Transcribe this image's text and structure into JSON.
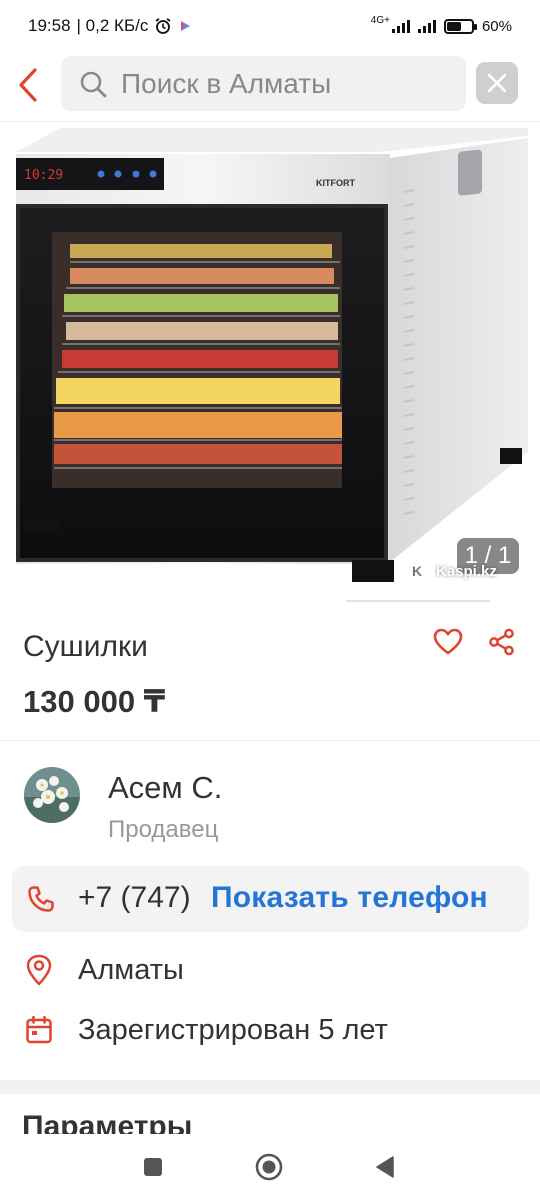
{
  "status_bar": {
    "time": "19:58",
    "speed": "| 0,2 КБ/с",
    "network": "4G+",
    "battery": "60%",
    "battery_level": 0.6
  },
  "search": {
    "placeholder": "Поиск в Алматы"
  },
  "photo": {
    "counter": "1 / 1",
    "watermark": "Kaspi.kz",
    "brand_label": "KITFORT",
    "display_digits": "10:29"
  },
  "listing": {
    "title": "Сушилки",
    "price": "130 000 ₸"
  },
  "seller": {
    "name": "Асем С.",
    "role": "Продавец"
  },
  "contact": {
    "phone_prefix": "+7 (747)",
    "show_phone_label": "Показать телефон",
    "city": "Алматы",
    "registered": "Зарегистрирован 5 лет"
  },
  "sections": {
    "params_title": "Параметры"
  },
  "colors": {
    "accent_red": "#e0432e",
    "link_blue": "#2375d6"
  },
  "icons": {
    "back": "chevron-left-icon",
    "search": "search-icon",
    "clear": "close-icon",
    "favorite": "heart-icon",
    "share": "share-icon",
    "phone": "phone-icon",
    "location": "location-pin-icon",
    "calendar": "calendar-icon"
  }
}
